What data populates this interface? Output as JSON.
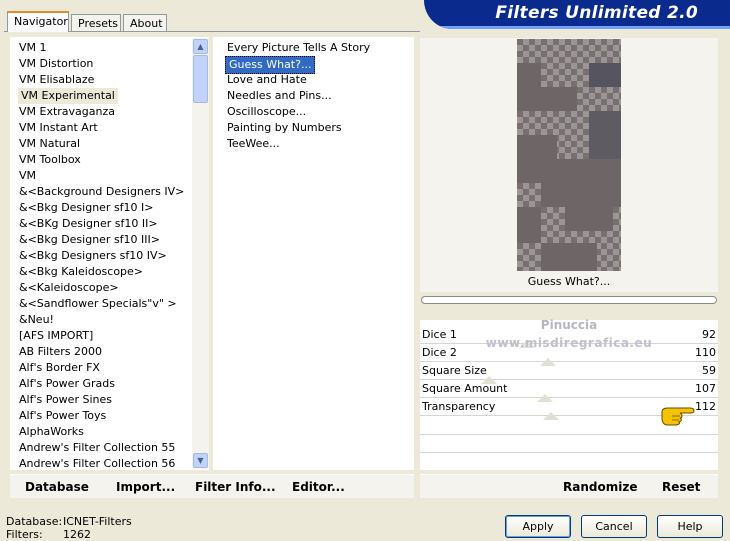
{
  "tabs": [
    {
      "label": "Navigator",
      "active": true
    },
    {
      "label": "Presets",
      "active": false
    },
    {
      "label": "About",
      "active": false
    }
  ],
  "banner": {
    "title": "Filters Unlimited 2.0",
    "color": "#0b2a8e"
  },
  "categories": {
    "selected": "VM Experimental",
    "items": [
      "VM 1",
      "VM Distortion",
      "VM Elisablaze",
      "VM Experimental",
      "VM Extravaganza",
      "VM Instant Art",
      "VM Natural",
      "VM Toolbox",
      "VM",
      "&<Background Designers IV>",
      "&<Bkg Designer sf10 I>",
      "&<BKg Designer sf10 II>",
      "&<Bkg Designer sf10 III>",
      "&<Bkg Designers sf10 IV>",
      "&<Bkg Kaleidoscope>",
      "&<Kaleidoscope>",
      "&<Sandflower Specials\"v\" >",
      "&Neu!",
      "[AFS IMPORT]",
      "AB Filters 2000",
      "Alf's Border FX",
      "Alf's Power Grads",
      "Alf's Power Sines",
      "Alf's Power Toys",
      "AlphaWorks",
      "Andrew's Filter Collection 55",
      "Andrew's Filter Collection 56"
    ]
  },
  "filters": {
    "selected": "Guess What?...",
    "items": [
      "Every Picture Tells A Story",
      "Guess What?...",
      "Love and Hate",
      "Needles and Pins...",
      "Oscilloscope...",
      "Painting by Numbers",
      "TeeWee..."
    ]
  },
  "preview": {
    "caption": "Guess What?..."
  },
  "watermark": {
    "line1": "Pinuccia",
    "line2": "www.misdiregrafica.eu"
  },
  "params": [
    {
      "label": "Dice 1",
      "value": "92",
      "level": 0.36
    },
    {
      "label": "Dice 2",
      "value": "110",
      "level": 0.43
    },
    {
      "label": "Square Size",
      "value": "59",
      "level": 0.23
    },
    {
      "label": "Square Amount",
      "value": "107",
      "level": 0.42
    },
    {
      "label": "Transparency",
      "value": "112",
      "level": 0.44
    }
  ],
  "toolbar_left": {
    "database": "Database",
    "import": "Import...",
    "filter_info": "Filter Info...",
    "editor": "Editor..."
  },
  "toolbar_right": {
    "randomize": "Randomize",
    "reset": "Reset"
  },
  "status": {
    "database_label": "Database:",
    "database_value": "ICNET-Filters",
    "filters_label": "Filters:",
    "filters_value": "1262"
  },
  "buttons": {
    "apply": "Apply",
    "cancel": "Cancel",
    "help": "Help"
  },
  "icons": {
    "pointer": "pointing-hand-icon",
    "scroll_up": "chevron-up-icon",
    "scroll_down": "chevron-down-icon"
  }
}
